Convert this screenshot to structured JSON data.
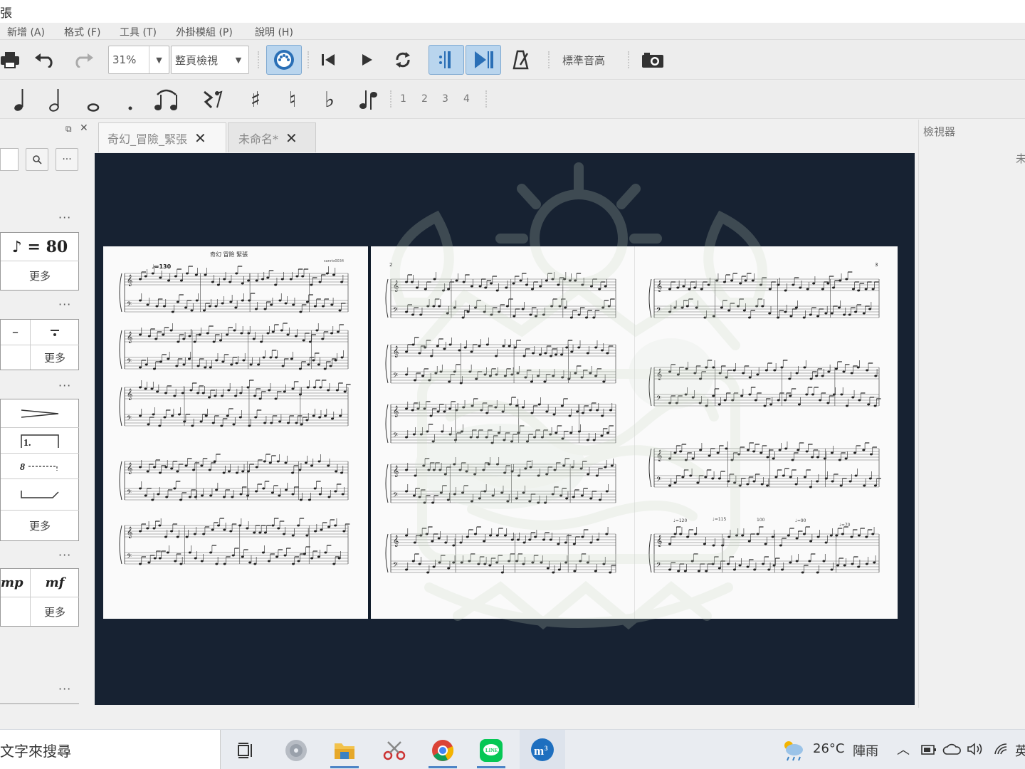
{
  "window": {
    "title_fragment": "張"
  },
  "menu": {
    "items": [
      {
        "label": "新增 (A)"
      },
      {
        "label": "格式 (F)"
      },
      {
        "label": "工具 (T)"
      },
      {
        "label": "外掛模組 (P)"
      },
      {
        "label": "說明 (H)"
      }
    ]
  },
  "toolbar": {
    "zoom_value": "31%",
    "view_mode": "整頁檢視",
    "concert_pitch_label": "標準音高",
    "voice_numbers": [
      "1",
      "2",
      "3",
      "4"
    ]
  },
  "note_input": {
    "quarter": "♩",
    "half": "𝅗𝅥",
    "whole": "o",
    "dot": ".",
    "sharp": "♯",
    "natural": "♮",
    "flat": "♭"
  },
  "palette": {
    "tempo_text": "♪ = 80",
    "more": "更多",
    "volta_text": "1.",
    "ottava_text": "8",
    "dynamic_mp": "mp",
    "dynamic_mf": "mf",
    "dots": "···"
  },
  "tabs": [
    {
      "label": "奇幻_冒險_緊張",
      "close": "✕"
    },
    {
      "label": "未命名*",
      "close": "✕"
    }
  ],
  "score": {
    "title": "奇幻 冒險 緊張",
    "composer": "sanrio0034",
    "tempo_first": "♩=130",
    "page_numbers": [
      "2",
      "3"
    ],
    "tempo_marks_last": [
      "♩=120",
      "♩=115",
      "100",
      "♩=90",
      "♩=70"
    ]
  },
  "inspector": {
    "title": "檢視器",
    "unnamed": "未"
  },
  "taskbar": {
    "search_text": "文字來搜尋",
    "weather_temp": "26°C",
    "weather_desc": "陣雨",
    "ime": "英"
  }
}
